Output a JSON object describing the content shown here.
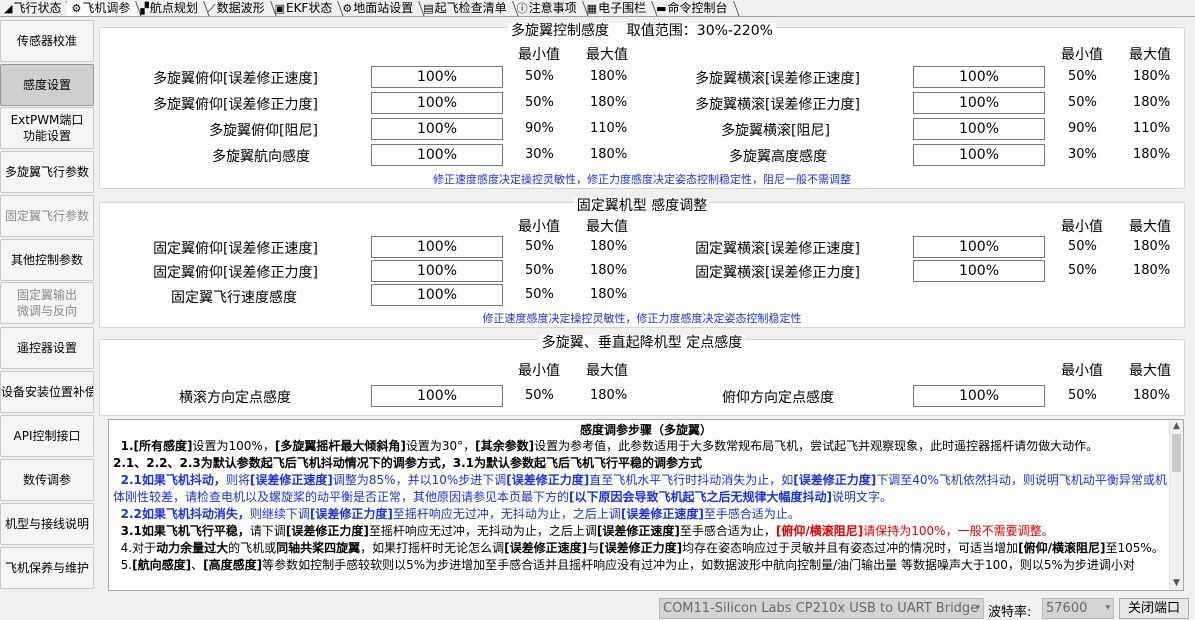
{
  "tabs": [
    {
      "icon": "◢",
      "label": "飞行状态"
    },
    {
      "icon": "⚙",
      "label": "飞机调参"
    },
    {
      "icon": "▞",
      "label": "航点规划"
    },
    {
      "icon": "⟋",
      "label": "数据波形"
    },
    {
      "icon": "▣",
      "label": "EKF状态"
    },
    {
      "icon": "⚙",
      "label": "地面站设置"
    },
    {
      "icon": "▤",
      "label": "起飞检查清单"
    },
    {
      "icon": "ⓘ",
      "label": "注意事项"
    },
    {
      "icon": "▦",
      "label": "电子围栏"
    },
    {
      "icon": "▬",
      "label": "命令控制台"
    }
  ],
  "sidebar": {
    "items": [
      "传感器校准",
      "感度设置",
      "ExtPWM端口\n功能设置",
      "多旋翼飞行参数",
      "固定翼飞行参数",
      "其他控制参数",
      "固定翼输出\n微调与反向",
      "遥控器设置",
      "设备安装位置补偿",
      "API控制接口",
      "数传调参",
      "机型与接线说明",
      "飞机保养与维护"
    ]
  },
  "common": {
    "min_header": "最小值",
    "max_header": "最大值"
  },
  "multirotor": {
    "title": "多旋翼控制感度",
    "range": "取值范围：30%-220%",
    "left": [
      {
        "label": "多旋翼俯仰[误差修正速度]",
        "value": "100%",
        "min": "50%",
        "max": "180%"
      },
      {
        "label": "多旋翼俯仰[误差修正力度]",
        "value": "100%",
        "min": "50%",
        "max": "180%"
      },
      {
        "label": "多旋翼俯仰[阻尼]",
        "value": "100%",
        "min": "90%",
        "max": "110%"
      },
      {
        "label": "多旋翼航向感度",
        "value": "100%",
        "min": "30%",
        "max": "180%"
      }
    ],
    "right": [
      {
        "label": "多旋翼横滚[误差修正速度]",
        "value": "100%",
        "min": "50%",
        "max": "180%"
      },
      {
        "label": "多旋翼横滚[误差修正力度]",
        "value": "100%",
        "min": "50%",
        "max": "180%"
      },
      {
        "label": "多旋翼横滚[阻尼]",
        "value": "100%",
        "min": "90%",
        "max": "110%"
      },
      {
        "label": "多旋翼高度感度",
        "value": "100%",
        "min": "30%",
        "max": "180%"
      }
    ],
    "hint": "修正速度感度决定操控灵敏性，修正力度感度决定姿态控制稳定性，阻尼一般不需调整"
  },
  "fixedwing": {
    "title": "固定翼机型 感度调整",
    "left": [
      {
        "label": "固定翼俯仰[误差修正速度]",
        "value": "100%",
        "min": "50%",
        "max": "180%"
      },
      {
        "label": "固定翼俯仰[误差修正力度]",
        "value": "100%",
        "min": "50%",
        "max": "180%"
      },
      {
        "label": "固定翼飞行速度感度",
        "value": "100%",
        "min": "50%",
        "max": "180%"
      }
    ],
    "right": [
      {
        "label": "固定翼横滚[误差修正速度]",
        "value": "100%",
        "min": "50%",
        "max": "180%"
      },
      {
        "label": "固定翼横滚[误差修正力度]",
        "value": "100%",
        "min": "50%",
        "max": "180%"
      }
    ],
    "hint": "修正速度感度决定操控灵敏性，修正力度感度决定姿态控制稳定性"
  },
  "hover": {
    "title": "多旋翼、垂直起降机型 定点感度",
    "left": {
      "label": "横滚方向定点感度",
      "value": "100%",
      "min": "50%",
      "max": "180%"
    },
    "right": {
      "label": "俯仰方向定点感度",
      "value": "100%",
      "min": "50%",
      "max": "180%"
    }
  },
  "steps": {
    "title": "感度调参步骤（多旋翼）",
    "l1_a": "1.[所有感度]",
    "l1_b": "设置为100%，",
    "l1_c": "[多旋翼摇杆最大倾斜角]",
    "l1_d": "设置为30°，",
    "l1_e": "[其余参数]",
    "l1_f": "设置为参考值，此参数适用于大多数常规布局飞机，尝试起飞并观察现象，此时遥控器摇杆请勿做大动作。",
    "l2": "2.1、2.2、2.3为默认参数起飞后飞机抖动情况下的调参方式，3.1为默认参数起飞后飞机飞行平稳的调参方式",
    "l3_a": "2.1如果飞机抖动，",
    "l3_b": "则将",
    "l3_c": "[误差修正速度]",
    "l3_d": "调整为85%，并以10%步进下调",
    "l3_e": "[误差修正力度]",
    "l3_f": "直至飞机水平飞行时抖动消失为止，如",
    "l3_g": "[误差修正力度]",
    "l3_h": "下调至40%飞机依然抖动，则说明飞机动平衡异常或机体刚性较差，请检查电机以及螺旋桨的动平衡是否正常，其他原因请参见本页最下方的",
    "l3_i": "[以下原因会导致飞机起飞之后无规律大幅度抖动]",
    "l3_j": "说明文字。",
    "l4_a": "2.2如果飞机抖动消失，",
    "l4_b": "则继续下调",
    "l4_c": "[误差修正力度]",
    "l4_d": "至摇杆响应无过冲，无抖动为止，之后上调",
    "l4_e": "[误差修正速度]",
    "l4_f": "至手感合适为止。",
    "l5_a": "3.1如果飞机飞行平稳，",
    "l5_b": "请下调",
    "l5_c": "[误差修正力度]",
    "l5_d": "至摇杆响应无过冲，无抖动为止，之后上调",
    "l5_e": "[误差修正速度]",
    "l5_f": "至手感合适为止，",
    "l5_g": "[俯仰/横滚阻尼]",
    "l5_h": "请保持为100%，一般不需要调整。",
    "l6_a": "4.对于",
    "l6_b": "动力余量过大",
    "l6_c": "的飞机或",
    "l6_d": "同轴共桨四旋翼",
    "l6_e": "，如果打摇杆时无论怎么调",
    "l6_f": "[误差修正速度]",
    "l6_g": "与",
    "l6_h": "[误差修正力度]",
    "l6_i": "均存在姿态响应过于灵敏并且有姿态过冲的情况时，可适当增加",
    "l6_j": "[俯仰/横滚阻尼]",
    "l6_k": "至105%。",
    "l7_a": "5.",
    "l7_b": "[航向感度]",
    "l7_c": "、",
    "l7_d": "[高度感度]",
    "l7_e": "等参数如控制手感较软则以5%为步进增加至手感合适并且摇杆响应没有过冲为止，如数据波形中航向控制量/油门输出量 等数据噪声大于100，则以5%为步进调小对"
  },
  "status": {
    "port": "COM11-Silicon Labs CP210x USB to UART Bridge",
    "baud_label": "波特率:",
    "baud": "57600",
    "close_button": "关闭端口"
  }
}
